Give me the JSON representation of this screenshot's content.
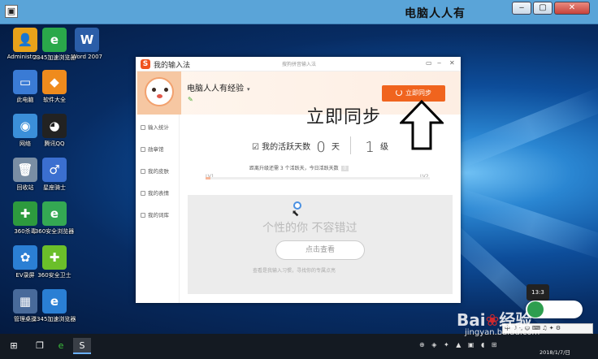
{
  "vm": {
    "title": "电脑人人有",
    "min": "‒",
    "max": "▢",
    "close": "✕"
  },
  "desktop_icons": [
    {
      "label": "Administra...",
      "glyph": "👤",
      "color": "#e8a21a"
    },
    {
      "label": "2345加速浏览器",
      "glyph": "e",
      "color": "#2aa84a"
    },
    {
      "label": "Word 2007",
      "glyph": "W",
      "color": "#2b5ea8"
    },
    {
      "label": "此电脑",
      "glyph": "▭",
      "color": "#3a7bd5"
    },
    {
      "label": "软件大全",
      "glyph": "◆",
      "color": "#ef8b1d"
    },
    {
      "label": "网络",
      "glyph": "◉",
      "color": "#3b8fd9"
    },
    {
      "label": "腾讯QQ",
      "glyph": "◕",
      "color": "#222222"
    },
    {
      "label": "回收站",
      "glyph": "🗑",
      "color": "#7a8ea4"
    },
    {
      "label": "星座骑士",
      "glyph": "♂",
      "color": "#3b6fd0"
    },
    {
      "label": "360杀毒",
      "glyph": "✚",
      "color": "#2d9a3e"
    },
    {
      "label": "360安全浏览器",
      "glyph": "e",
      "color": "#34a853"
    },
    {
      "label": "EV录屏",
      "glyph": "✿",
      "color": "#2b7fd4"
    },
    {
      "label": "360安全卫士",
      "glyph": "✚",
      "color": "#6bbf2a"
    },
    {
      "label": "管理桌面",
      "glyph": "▦",
      "color": "#486a9a"
    },
    {
      "label": "2345加速浏览器",
      "glyph": "e",
      "color": "#2a7fd4"
    }
  ],
  "window": {
    "app_title": "我的输入法",
    "subtitle": "搜狗拼音输入法",
    "controls": [
      "▭",
      "‒",
      "✕"
    ],
    "username": "电脑人人有经验",
    "caret": "▾",
    "sync_button": "立即同步",
    "nav": [
      "输入统计",
      "勋章馆",
      "我的皮肤",
      "我的表情",
      "我的词库"
    ],
    "active_label": "我的活跃天数",
    "days": "0",
    "day_unit": "天",
    "level": "1",
    "level_unit": "级",
    "upgrade_tip": "距离升级还需 3 个活跃天，今日活跃天数",
    "upgrade_tag": "0",
    "lv_start": "LV1",
    "lv_end": "LV2",
    "level_progress": 0.02,
    "feed_slogan": "个性的你  不容错过",
    "view_button": "点击查看",
    "feed_hint": "查看是我输入习惯，寻找你的专属点亮"
  },
  "annotation": {
    "text": "立即同步"
  },
  "right_float": {
    "time": "13:3",
    "ime_bar": "中 ☽ ·, ☺ ⌨ ♫ ✦ ⚙"
  },
  "taskbar": {
    "start": "⊞",
    "taskview": "❐",
    "browser": "e",
    "sogou": "S",
    "tray": "⊕ ◈ ✦ ▲ ▣ ◖ ⊞",
    "date": "2018/1/7/日"
  },
  "watermark": {
    "brand_a": "Bai",
    "brand_paw": "❀",
    "brand_b": "经验",
    "url": "jingyan.baidu.com"
  },
  "colors": {
    "accent": "#f0641e",
    "desktop": "#0d4d9a"
  }
}
